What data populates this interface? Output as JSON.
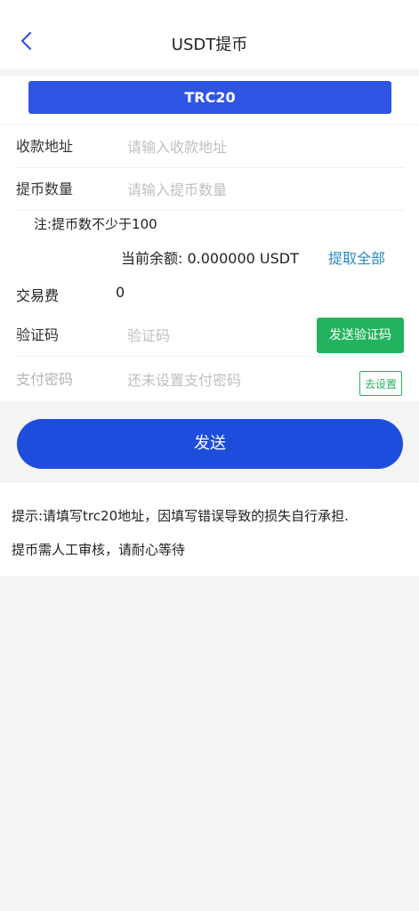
{
  "header": {
    "title": "USDT提币"
  },
  "tabs": [
    {
      "label": "TRC20",
      "active": true
    }
  ],
  "form": {
    "address": {
      "label": "收款地址",
      "placeholder": "请输入收款地址",
      "value": ""
    },
    "amount": {
      "label": "提币数量",
      "placeholder": "请输入提币数量",
      "value": ""
    },
    "note": "注:提币数不少于100",
    "balance": {
      "text": "当前余额: 0.000000 USDT",
      "withdraw_all_label": "提取全部"
    },
    "fee": {
      "label": "交易费",
      "value": "0"
    },
    "code": {
      "label": "验证码",
      "placeholder": "验证码",
      "value": "",
      "send_label": "发送验证码"
    },
    "password": {
      "label": "支付密码",
      "placeholder": "还未设置支付密码",
      "value": "",
      "set_label": "去设置"
    }
  },
  "submit_label": "发送",
  "tips": [
    "提示:请填写trc20地址，因填写错误导致的损失自行承担.",
    "提币需人工审核，请耐心等待"
  ],
  "colors": {
    "primary": "#2f55e4",
    "button": "#1e4ddd",
    "success": "#23b35e",
    "link": "#2a8ac6",
    "background": "#f4f4f5"
  }
}
